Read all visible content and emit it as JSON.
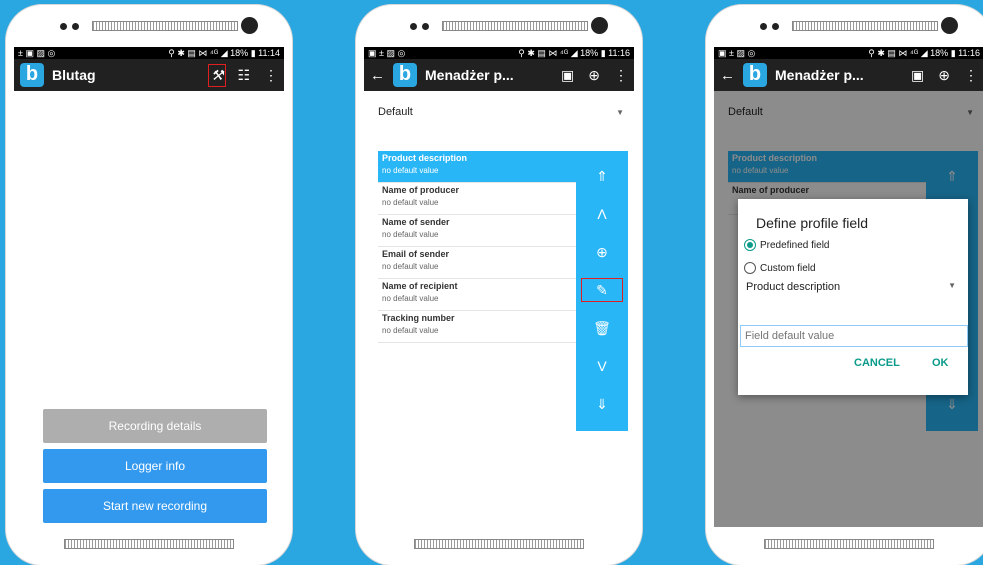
{
  "phone1": {
    "status": {
      "left": "± ▣ ▨ ◎",
      "right": "⚲ ✱ ▤ ⋈ ⁴ᴳ ◢ 18% ▮ 11:14"
    },
    "logo_letter": "b",
    "title": "Blutag",
    "buttons": {
      "recording_details": "Recording details",
      "logger_info": "Logger info",
      "start_new_recording": "Start new recording"
    }
  },
  "phone2": {
    "status": {
      "left": "▣ ± ▨ ◎",
      "right": "⚲ ✱ ▤ ⋈ ⁴ᴳ ◢ 18% ▮ 11:16"
    },
    "logo_letter": "b",
    "title": "Menadżer p...",
    "dropdown": "Default",
    "fields": [
      {
        "name": "Product description",
        "value": "no default value"
      },
      {
        "name": "Name of producer",
        "value": "no default value"
      },
      {
        "name": "Name of sender",
        "value": "no default value"
      },
      {
        "name": "Email of sender",
        "value": "no default value"
      },
      {
        "name": "Name of recipient",
        "value": "no default value"
      },
      {
        "name": "Tracking number",
        "value": "no default value"
      }
    ],
    "selected_index": 0
  },
  "phone3": {
    "status": {
      "left": "▣ ± ▨ ◎",
      "right": "⚲ ✱ ▤ ⋈ ⁴ᴳ ◢ 18% ▮ 11:16"
    },
    "logo_letter": "b",
    "title": "Menadżer p...",
    "dropdown": "Default",
    "fields": [
      {
        "name": "Product description",
        "value": "no default value"
      },
      {
        "name": "Name of producer"
      }
    ],
    "dialog": {
      "title": "Define profile field",
      "predefined": "Predefined field",
      "custom": "Custom field",
      "selected_option": "predefined",
      "field_select": "Product description",
      "input_placeholder": "Field default value",
      "cancel": "CANCEL",
      "ok": "OK"
    }
  },
  "colors": {
    "background": "#2aa6e0",
    "appbar": "#212121",
    "accent": "#29b6f6",
    "dialog_accent": "#0a9b8a",
    "highlight": "#e02020"
  }
}
